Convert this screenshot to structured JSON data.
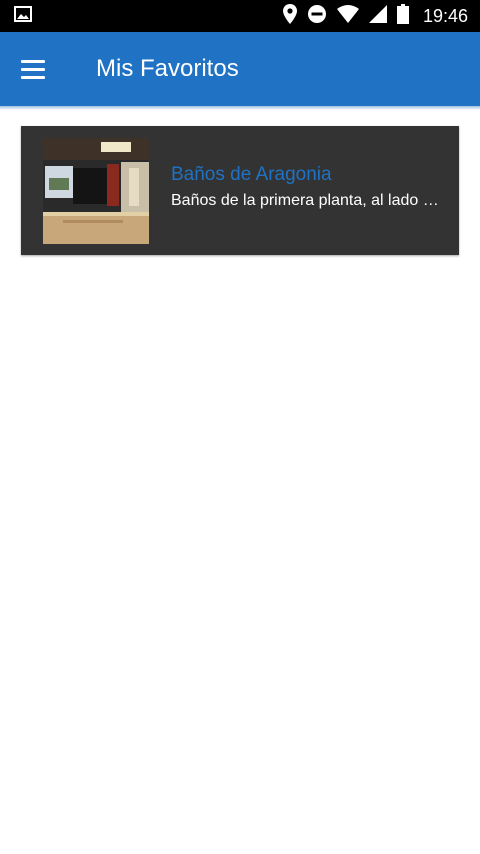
{
  "status_bar": {
    "time": "19:46",
    "icons": [
      "image-icon",
      "location-icon",
      "dnd-icon",
      "wifi-icon",
      "signal-icon",
      "battery-icon"
    ]
  },
  "app_bar": {
    "title": "Mis Favoritos",
    "menu_icon": "hamburger-menu-icon",
    "color": "#1f72c4"
  },
  "favorites": [
    {
      "title": "Baños de Aragonia",
      "description": "Baños de la primera planta, al lado de…",
      "thumbnail": "photo-thumbnail"
    }
  ],
  "colors": {
    "accent": "#1f72c4",
    "card_bg": "#333333"
  }
}
